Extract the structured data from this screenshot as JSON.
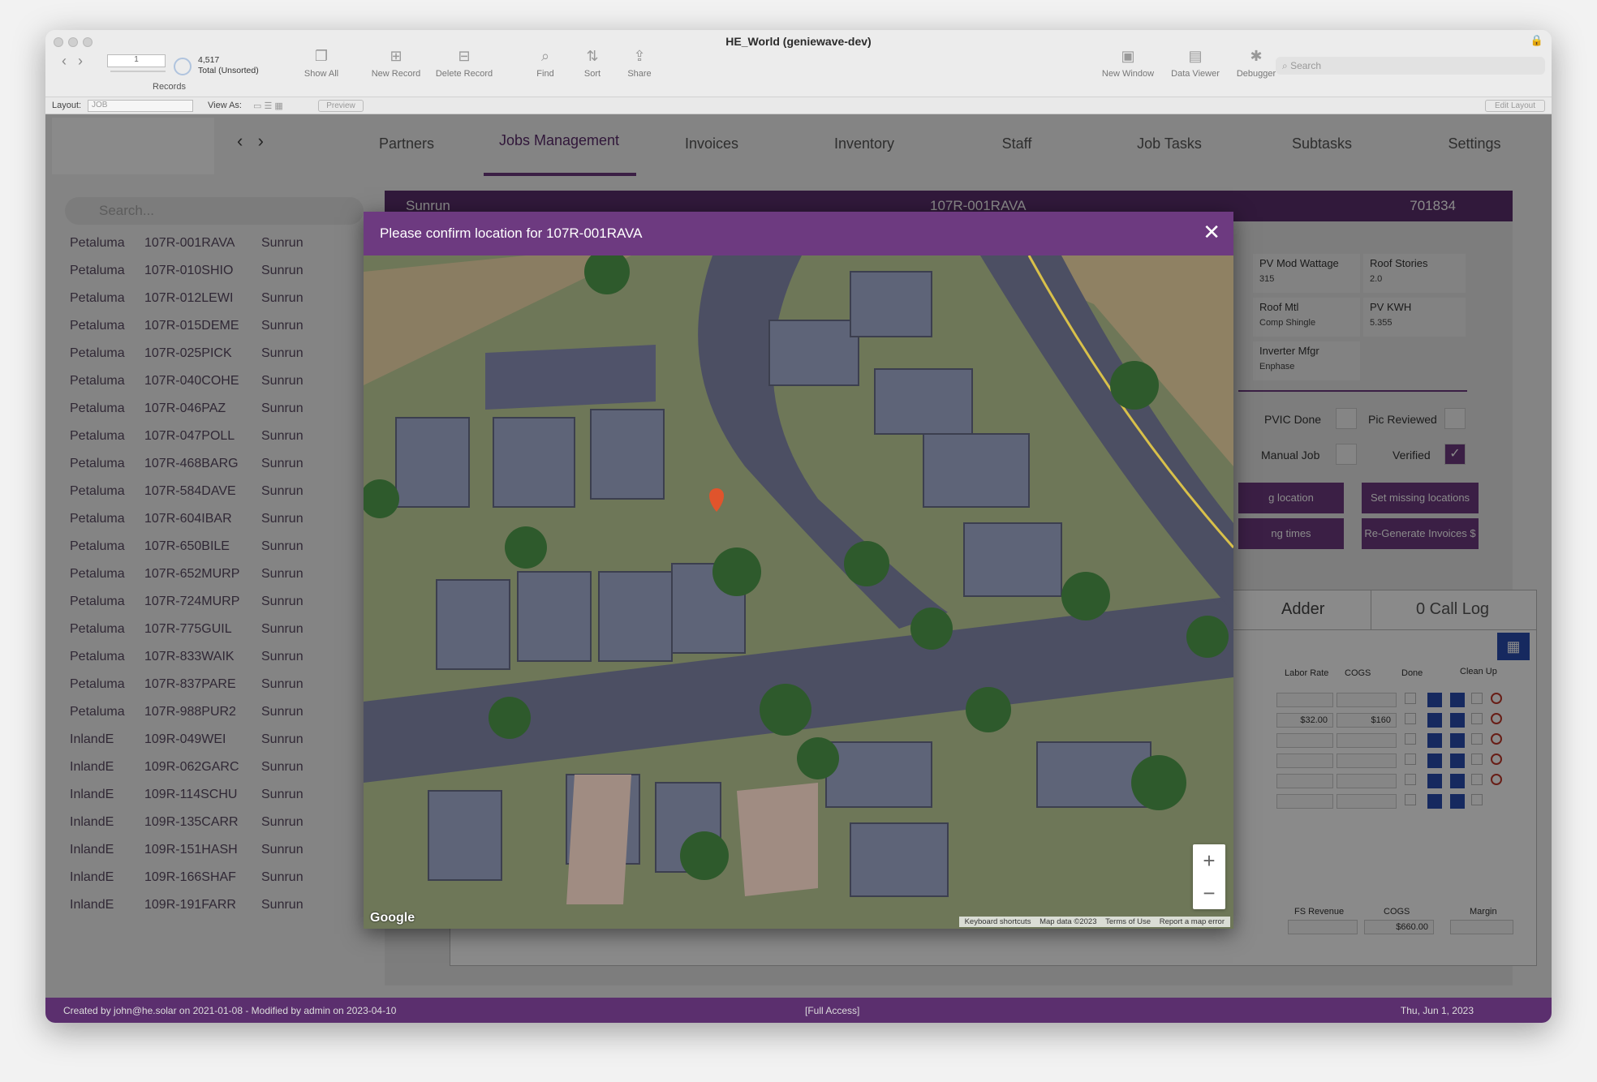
{
  "window": {
    "title": "HE_World (geniewave-dev)"
  },
  "toolbar": {
    "record_number": "1",
    "records_total": "4,517",
    "records_status": "Total (Unsorted)",
    "records_label": "Records",
    "show_all": "Show All",
    "new_record": "New Record",
    "delete_record": "Delete Record",
    "find": "Find",
    "sort": "Sort",
    "share": "Share",
    "new_window": "New Window",
    "data_viewer": "Data Viewer",
    "debugger": "Debugger",
    "search_placeholder": "Search"
  },
  "layoutbar": {
    "layout_label": "Layout:",
    "layout_value": "JOB",
    "view_as_label": "View As:",
    "preview": "Preview",
    "edit_layout": "Edit Layout"
  },
  "menu": {
    "items": [
      "Partners",
      "Jobs Management",
      "Invoices",
      "Inventory",
      "Staff",
      "Job Tasks",
      "Subtasks",
      "Settings"
    ],
    "active": "Jobs Management"
  },
  "sidebar": {
    "search_placeholder": "Search...",
    "rows": [
      {
        "region": "Petaluma",
        "code": "107R-001RAVA",
        "partner": "Sunrun"
      },
      {
        "region": "Petaluma",
        "code": "107R-010SHIO",
        "partner": "Sunrun"
      },
      {
        "region": "Petaluma",
        "code": "107R-012LEWI",
        "partner": "Sunrun"
      },
      {
        "region": "Petaluma",
        "code": "107R-015DEME",
        "partner": "Sunrun"
      },
      {
        "region": "Petaluma",
        "code": "107R-025PICK",
        "partner": "Sunrun"
      },
      {
        "region": "Petaluma",
        "code": "107R-040COHE",
        "partner": "Sunrun"
      },
      {
        "region": "Petaluma",
        "code": "107R-046PAZ",
        "partner": "Sunrun"
      },
      {
        "region": "Petaluma",
        "code": "107R-047POLL",
        "partner": "Sunrun"
      },
      {
        "region": "Petaluma",
        "code": "107R-468BARG",
        "partner": "Sunrun"
      },
      {
        "region": "Petaluma",
        "code": "107R-584DAVE",
        "partner": "Sunrun"
      },
      {
        "region": "Petaluma",
        "code": "107R-604IBAR",
        "partner": "Sunrun"
      },
      {
        "region": "Petaluma",
        "code": "107R-650BILE",
        "partner": "Sunrun"
      },
      {
        "region": "Petaluma",
        "code": "107R-652MURP",
        "partner": "Sunrun"
      },
      {
        "region": "Petaluma",
        "code": "107R-724MURP",
        "partner": "Sunrun"
      },
      {
        "region": "Petaluma",
        "code": "107R-775GUIL",
        "partner": "Sunrun"
      },
      {
        "region": "Petaluma",
        "code": "107R-833WAIK",
        "partner": "Sunrun"
      },
      {
        "region": "Petaluma",
        "code": "107R-837PARE",
        "partner": "Sunrun"
      },
      {
        "region": "Petaluma",
        "code": "107R-988PUR2",
        "partner": "Sunrun"
      },
      {
        "region": "InlandE",
        "code": "109R-049WEI",
        "partner": "Sunrun"
      },
      {
        "region": "InlandE",
        "code": "109R-062GARC",
        "partner": "Sunrun"
      },
      {
        "region": "InlandE",
        "code": "109R-114SCHU",
        "partner": "Sunrun"
      },
      {
        "region": "InlandE",
        "code": "109R-135CARR",
        "partner": "Sunrun"
      },
      {
        "region": "InlandE",
        "code": "109R-151HASH",
        "partner": "Sunrun"
      },
      {
        "region": "InlandE",
        "code": "109R-166SHAF",
        "partner": "Sunrun"
      },
      {
        "region": "InlandE",
        "code": "109R-191FARR",
        "partner": "Sunrun"
      }
    ]
  },
  "job": {
    "partner": "Sunrun",
    "code": "107R-001RAVA",
    "number": "701834",
    "fields": {
      "pv_mod_wattage_label": "PV Mod Wattage",
      "pv_mod_wattage": "315",
      "roof_stories_label": "Roof Stories",
      "roof_stories": "2.0",
      "roof_mtl_label": "Roof Mtl",
      "roof_mtl": "Comp Shingle",
      "pv_kwh_label": "PV KWH",
      "pv_kwh": "5.355",
      "inverter_mfgr_label": "Inverter Mfgr",
      "inverter_mfgr": "Enphase"
    },
    "checks": {
      "pvic_done": "PVIC Done",
      "pic_reviewed": "Pic Reviewed",
      "manual_job": "Manual Job",
      "verified": "Verified"
    },
    "buttons": {
      "location": "g location",
      "set_missing": "Set missing locations",
      "times": "ng times",
      "regen": "Re-Generate Invoices $"
    },
    "tabs": {
      "adder": "Adder",
      "call_log": "0 Call Log"
    },
    "table": {
      "headers": [
        "Labor Rate",
        "COGS",
        "Done",
        "Clean Up"
      ],
      "row2_rate": "$32.00",
      "row2_cogs": "$160"
    },
    "totals": {
      "fs_revenue_label": "FS Revenue",
      "cogs_label": "COGS",
      "margin_label": "Margin",
      "cogs": "$660.00"
    }
  },
  "footer": {
    "created": "Created by john@he.solar on 2021-01-08 - Modified by admin on 2023-04-10",
    "access": "[Full Access]",
    "date": "Thu, Jun 1, 2023"
  },
  "modal": {
    "title": "Please confirm location for 107R-001RAVA",
    "map": {
      "zoom_in": "+",
      "zoom_out": "−",
      "logo": "Google",
      "keyboard": "Keyboard shortcuts",
      "map_data": "Map data ©2023",
      "terms": "Terms of Use",
      "report": "Report a map error"
    }
  },
  "colors": {
    "brand": "#6d3a80",
    "header": "#5b2f6e",
    "marker": "#e0542c"
  }
}
